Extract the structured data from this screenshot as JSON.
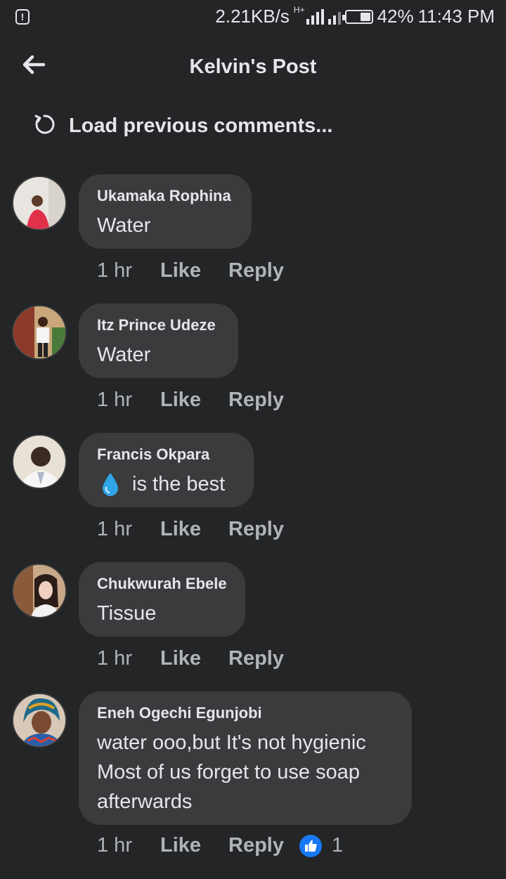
{
  "status": {
    "alert_icon": "alert-icon",
    "speed": "2.21KB/s",
    "network": "H+",
    "battery_percent": "42%",
    "battery_level": 0.42,
    "time": "11:43 PM"
  },
  "header": {
    "title": "Kelvin's Post",
    "back_icon": "back-arrow-icon"
  },
  "load_previous": {
    "label": "Load previous comments...",
    "icon": "refresh-icon"
  },
  "actions": {
    "like": "Like",
    "reply": "Reply"
  },
  "comments": [
    {
      "author": "Ukamaka Rophina",
      "text": "Water",
      "time": "1 hr"
    },
    {
      "author": "Itz Prince Udeze",
      "text": "Water",
      "time": "1 hr"
    },
    {
      "author": "Francis Okpara",
      "text": " is the best",
      "emoji": "droplet",
      "time": "1 hr"
    },
    {
      "author": "Chukwurah Ebele",
      "text": "Tissue",
      "time": "1 hr"
    },
    {
      "author": "Eneh Ogechi Egunjobi",
      "lines": [
        "water ooo,but It's not hygienic",
        "Most of us forget to use soap",
        "afterwards"
      ],
      "time": "1 hr",
      "reaction_count": "1",
      "reaction_icon": "like-reaction-icon"
    }
  ],
  "colors": {
    "background": "#242526",
    "bubble": "#3a3b3c",
    "text": "#e4e6eb",
    "muted": "#b0b3b8",
    "like_blue": "#1877f2"
  }
}
